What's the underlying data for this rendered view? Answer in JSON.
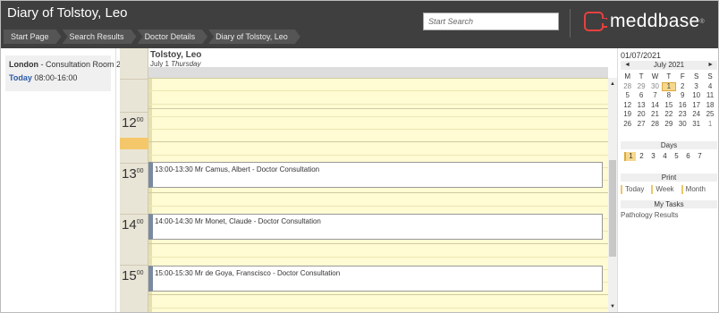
{
  "header": {
    "title": "Diary of Tolstoy, Leo",
    "breadcrumbs": [
      "Start Page",
      "Search Results",
      "Doctor Details",
      "Diary of Tolstoy, Leo"
    ],
    "search_placeholder": "Start Search",
    "logo_text": "meddbase",
    "logo_reg": "®"
  },
  "left_panel": {
    "location": "London",
    "room": " - Consultation Room 2",
    "today_label": "Today",
    "hours": " 08:00-16:00"
  },
  "diary": {
    "doctor_name": "Tolstoy, Leo",
    "date_text": "July 1 ",
    "weekday": "Thursday",
    "hours": [
      {
        "hour": "12",
        "minutes": "00"
      },
      {
        "hour": "13",
        "minutes": "00"
      },
      {
        "hour": "14",
        "minutes": "00"
      },
      {
        "hour": "15",
        "minutes": "00"
      }
    ],
    "appointments": [
      {
        "text": "13:00-13:30 Mr Camus, Albert - Doctor Consultation"
      },
      {
        "text": "14:00-14:30 Mr Monet, Claude - Doctor Consultation"
      },
      {
        "text": "15:00-15:30 Mr de Goya, Franscisco - Doctor Consultation"
      }
    ]
  },
  "calendar": {
    "selected_date": "01/07/2021",
    "month_label": "July 2021",
    "prev_symbol": "◄",
    "next_symbol": "►",
    "weekdays": [
      "M",
      "T",
      "W",
      "T",
      "F",
      "S",
      "S"
    ],
    "weeks": [
      [
        "28",
        "29",
        "30",
        "1",
        "2",
        "3",
        "4"
      ],
      [
        "5",
        "6",
        "7",
        "8",
        "9",
        "10",
        "11"
      ],
      [
        "12",
        "13",
        "14",
        "15",
        "16",
        "17",
        "18"
      ],
      [
        "19",
        "20",
        "21",
        "22",
        "23",
        "24",
        "25"
      ],
      [
        "26",
        "27",
        "28",
        "29",
        "30",
        "31",
        "1"
      ]
    ]
  },
  "days_section": {
    "label": "Days",
    "options": [
      "1",
      "2",
      "3",
      "4",
      "5",
      "6",
      "7"
    ],
    "active": "1"
  },
  "print_section": {
    "label": "Print",
    "options": [
      "Today",
      "Week",
      "Month"
    ]
  },
  "tasks_section": {
    "label": "My Tasks",
    "items": [
      "Pathology Results"
    ]
  },
  "scrollbar": {
    "up_symbol": "▲",
    "down_symbol": "▼"
  }
}
